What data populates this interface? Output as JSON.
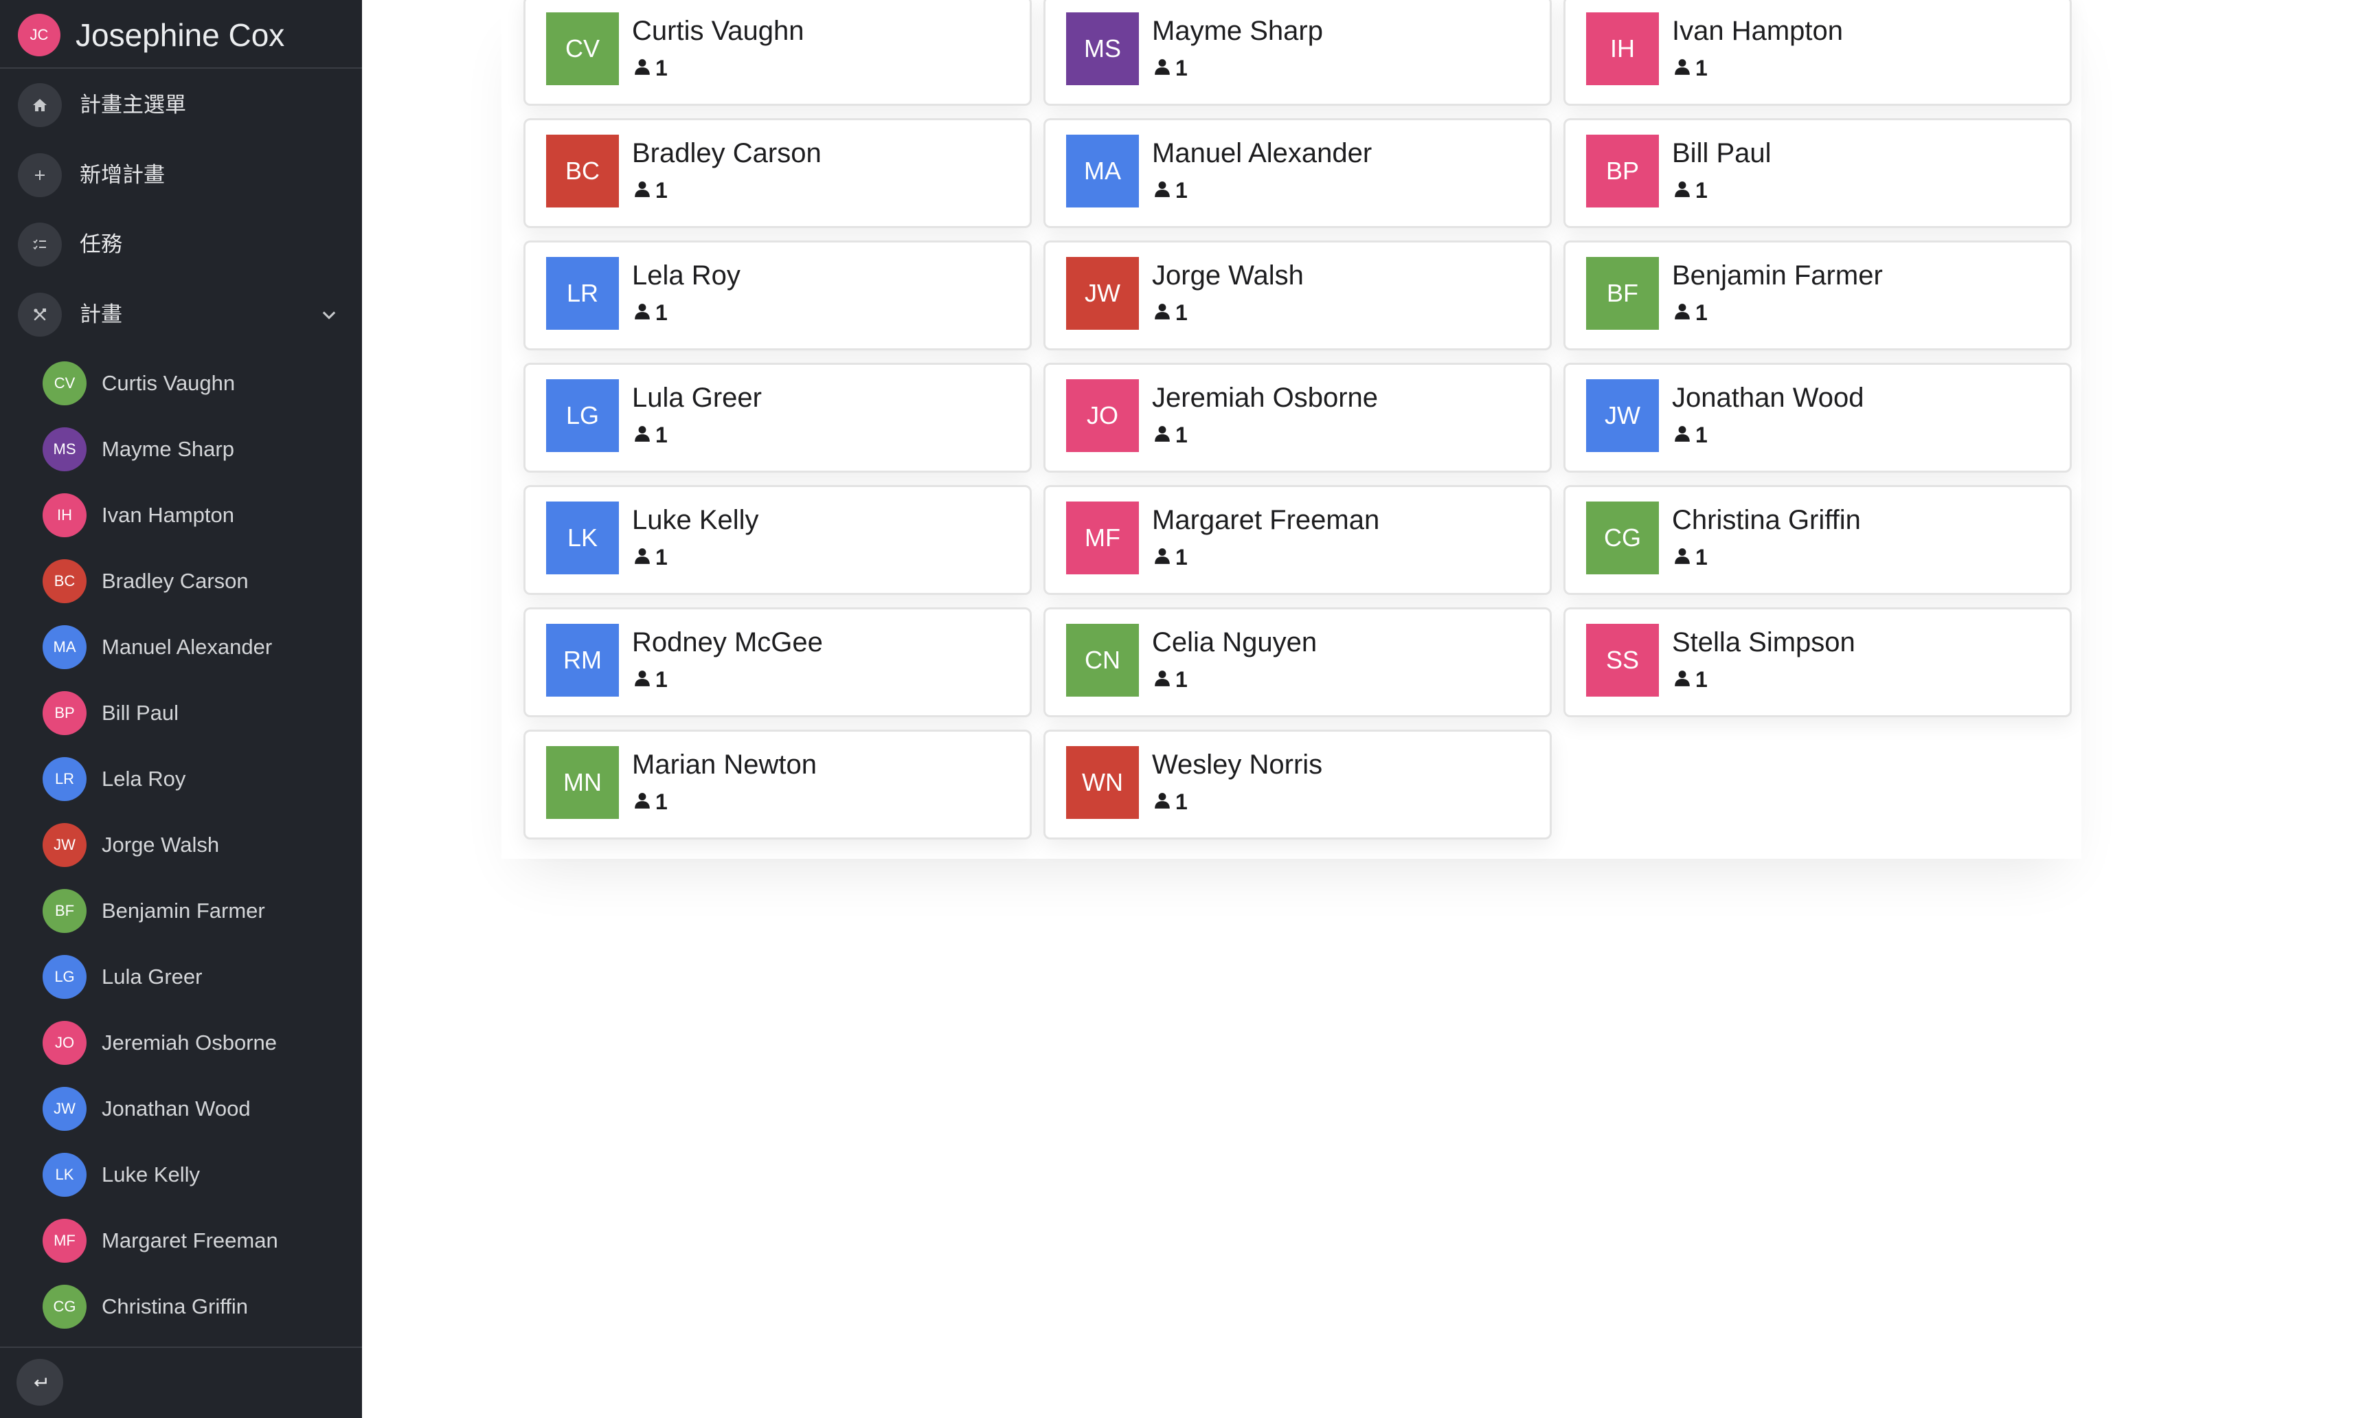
{
  "user": {
    "initials": "JC",
    "name": "Josephine Cox",
    "color": "#e5487a"
  },
  "nav": [
    {
      "label": "計畫主選單",
      "icon": "home-icon"
    },
    {
      "label": "新增計畫",
      "icon": "plus-icon"
    },
    {
      "label": "任務",
      "icon": "task-list-icon"
    },
    {
      "label": "計畫",
      "icon": "tools-icon"
    }
  ],
  "colors": {
    "green": "#6aa84f",
    "purple": "#6f3f99",
    "pink": "#e5487a",
    "red": "#cc4236",
    "blue": "#4a80e8"
  },
  "plans": [
    {
      "initials": "CV",
      "name": "Curtis Vaughn",
      "color": "green",
      "members": "1"
    },
    {
      "initials": "MS",
      "name": "Mayme Sharp",
      "color": "purple",
      "members": "1"
    },
    {
      "initials": "IH",
      "name": "Ivan Hampton",
      "color": "pink",
      "members": "1"
    },
    {
      "initials": "BC",
      "name": "Bradley Carson",
      "color": "red",
      "members": "1"
    },
    {
      "initials": "MA",
      "name": "Manuel Alexander",
      "color": "blue",
      "members": "1"
    },
    {
      "initials": "BP",
      "name": "Bill Paul",
      "color": "pink",
      "members": "1"
    },
    {
      "initials": "LR",
      "name": "Lela Roy",
      "color": "blue",
      "members": "1"
    },
    {
      "initials": "JW",
      "name": "Jorge Walsh",
      "color": "red",
      "members": "1"
    },
    {
      "initials": "BF",
      "name": "Benjamin Farmer",
      "color": "green",
      "members": "1"
    },
    {
      "initials": "LG",
      "name": "Lula Greer",
      "color": "blue",
      "members": "1"
    },
    {
      "initials": "JO",
      "name": "Jeremiah Osborne",
      "color": "pink",
      "members": "1"
    },
    {
      "initials": "JW",
      "name": "Jonathan Wood",
      "color": "blue",
      "members": "1"
    },
    {
      "initials": "LK",
      "name": "Luke Kelly",
      "color": "blue",
      "members": "1"
    },
    {
      "initials": "MF",
      "name": "Margaret Freeman",
      "color": "pink",
      "members": "1"
    },
    {
      "initials": "CG",
      "name": "Christina Griffin",
      "color": "green",
      "members": "1"
    },
    {
      "initials": "RM",
      "name": "Rodney McGee",
      "color": "blue",
      "members": "1"
    },
    {
      "initials": "CN",
      "name": "Celia Nguyen",
      "color": "green",
      "members": "1"
    },
    {
      "initials": "SS",
      "name": "Stella Simpson",
      "color": "pink",
      "members": "1"
    },
    {
      "initials": "MN",
      "name": "Marian Newton",
      "color": "green",
      "members": "1"
    },
    {
      "initials": "WN",
      "name": "Wesley Norris",
      "color": "red",
      "members": "1"
    }
  ]
}
